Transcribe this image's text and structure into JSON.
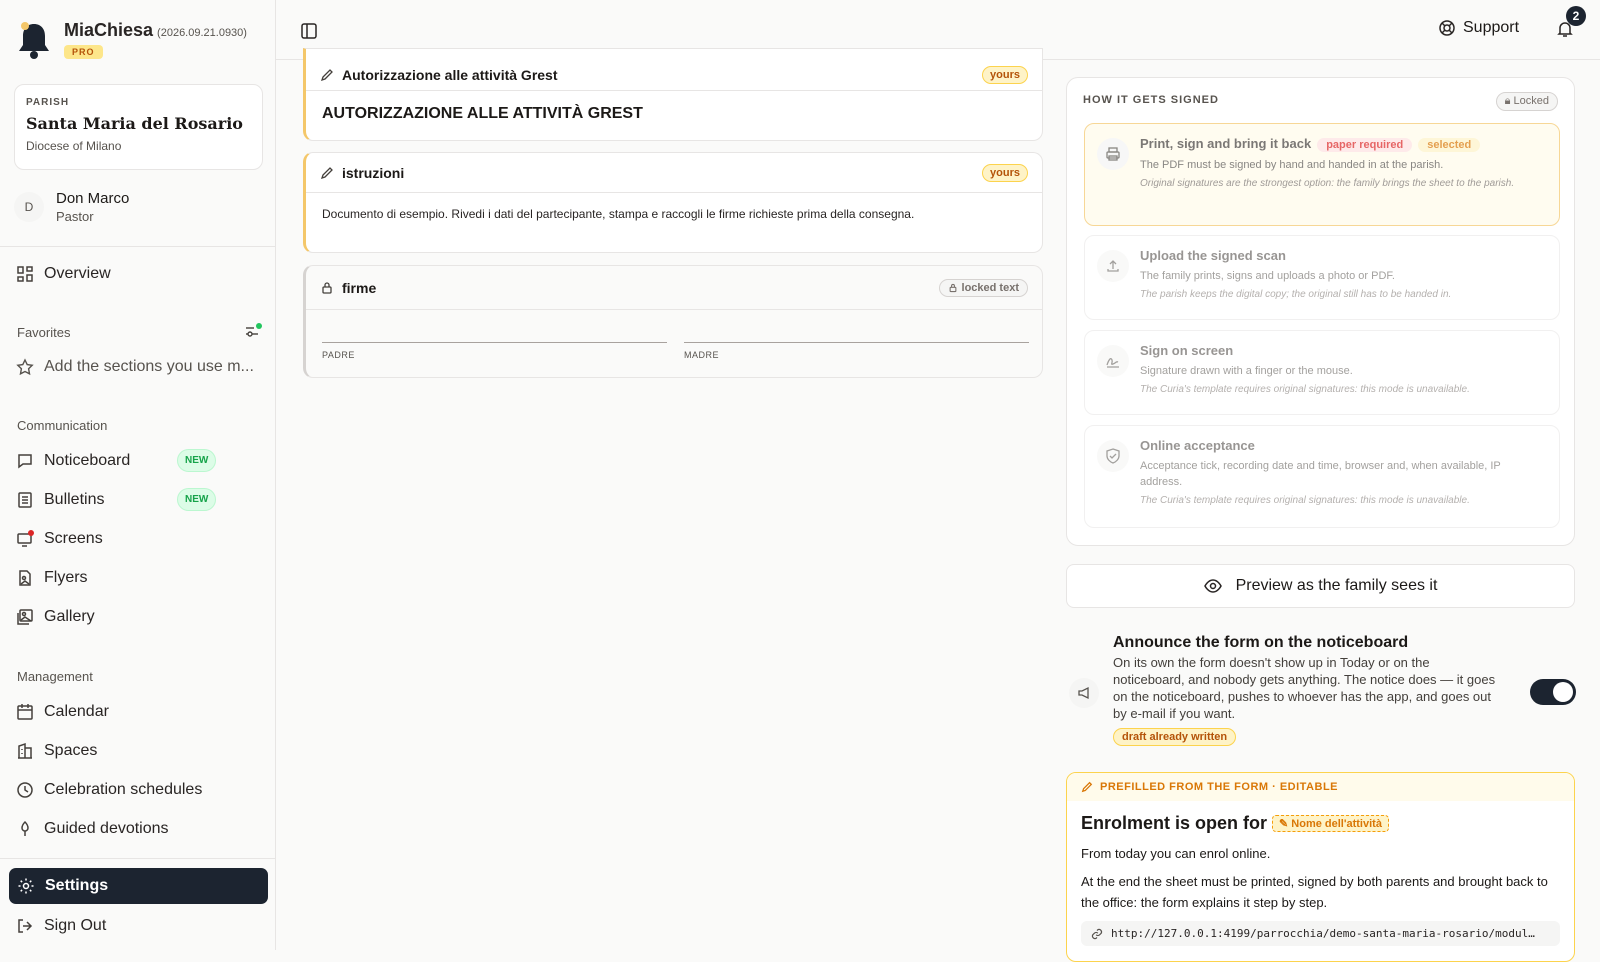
{
  "app": {
    "name": "MiaChiesa",
    "version": "(2026.09.21.0930)",
    "plan_badge": "PRO"
  },
  "parish": {
    "label": "PARISH",
    "name": "Santa Maria del Rosario",
    "diocese": "Diocese of Milano"
  },
  "user": {
    "initial": "D",
    "name": "Don Marco",
    "role": "Pastor"
  },
  "nav": {
    "overview": "Overview",
    "favorites_label": "Favorites",
    "favorites_hint": "Add the sections you use m...",
    "communication_label": "Communication",
    "noticeboard": "Noticeboard",
    "bulletins": "Bulletins",
    "new_badge": "NEW",
    "screens": "Screens",
    "flyers": "Flyers",
    "gallery": "Gallery",
    "management_label": "Management",
    "calendar": "Calendar",
    "spaces": "Spaces",
    "celebration": "Celebration schedules",
    "devotions": "Guided devotions",
    "settings": "Settings",
    "signout": "Sign Out"
  },
  "topbar": {
    "support": "Support",
    "notifications_count": "2"
  },
  "form": {
    "title_block": {
      "label": "Autorizzazione alle attività Grest",
      "badge": "yours",
      "content": "AUTORIZZAZIONE ALLE ATTIVITÀ GREST"
    },
    "instructions_block": {
      "label": "istruzioni",
      "badge": "yours",
      "content": "Documento di esempio. Rivedi i dati del partecipante, stampa e raccogli le firme richieste prima della consegna."
    },
    "signatures_block": {
      "label": "firme",
      "badge": "locked text",
      "sig1": "PADRE",
      "sig2": "MADRE"
    }
  },
  "signing": {
    "title": "HOW IT GETS SIGNED",
    "locked": "Locked",
    "options": [
      {
        "title": "Print, sign and bring it back",
        "chip1": "paper required",
        "chip2": "selected",
        "desc": "The PDF must be signed by hand and handed in at the parish.",
        "note": "Original signatures are the strongest option: the family brings the sheet to the parish."
      },
      {
        "title": "Upload the signed scan",
        "desc": "The family prints, signs and uploads a photo or PDF.",
        "note": "The parish keeps the digital copy; the original still has to be handed in."
      },
      {
        "title": "Sign on screen",
        "desc": "Signature drawn with a finger or the mouse.",
        "note": "The Curia's template requires original signatures: this mode is unavailable."
      },
      {
        "title": "Online acceptance",
        "desc": "Acceptance tick, recording date and time, browser and, when available, IP address.",
        "note": "The Curia's template requires original signatures: this mode is unavailable."
      }
    ]
  },
  "preview_button": "Preview as the family sees it",
  "announce": {
    "title": "Announce the form on the noticeboard",
    "desc": "On its own the form doesn't show up in Today or on the noticeboard, and nobody gets anything. The notice does — it goes on the noticeboard, pushes to whoever has the app, and goes out by e-mail if you want.",
    "draft_badge": "draft already written",
    "toggle_on": true
  },
  "prefill": {
    "label": "PREFILLED FROM THE FORM · EDITABLE",
    "heading": "Enrolment is open for",
    "placeholder": "Nome dell'attività",
    "p1": "From today you can enrol online.",
    "p2": "At the end the sheet must be printed, signed by both parents and brought back to the office: the form explains it step by step.",
    "link": "http://127.0.0.1:4199/parrocchia/demo-santa-maria-rosario/modul…"
  },
  "colors": {
    "accent": "#f4c76a",
    "dark": "#1c2430",
    "new_green": "#16a34a",
    "badge_red": "#dc2626"
  }
}
